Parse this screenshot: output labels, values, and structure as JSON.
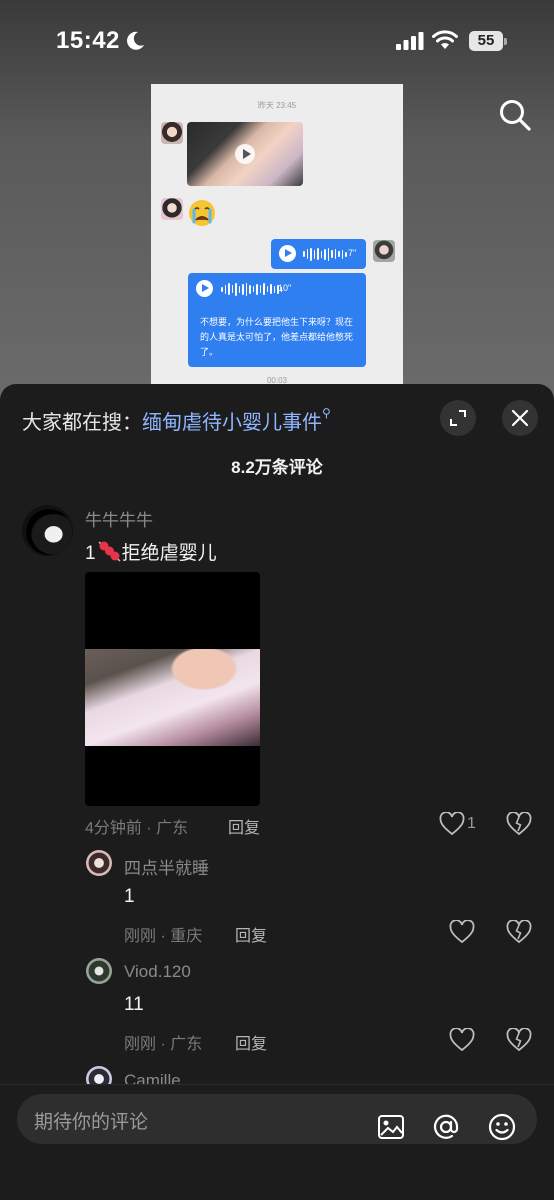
{
  "status_bar": {
    "time": "15:42",
    "battery": "55"
  },
  "chat_screenshot": {
    "timestamp": "昨天 23:45",
    "voice1_duration": "7\"",
    "voice2_duration": "10\"",
    "voice2_transcript": "不想要，为什么要把他生下来呀？现在的人真是太可怕了，他差点都给他憋死了。",
    "bottom_time": "00:03"
  },
  "panel": {
    "hot_search_prefix": "大家都在搜：",
    "hot_search_keyword": "缅甸虐待小婴儿事件",
    "comment_count": "8.2万条评论"
  },
  "comments": [
    {
      "username": "牛牛牛牛",
      "text_prefix": "1",
      "text": "拒绝虐婴儿",
      "meta": "4分钟前 · 广东",
      "reply_label": "回复",
      "likes": "1"
    }
  ],
  "replies": [
    {
      "username": "四点半就睡",
      "text": "1",
      "meta": "刚刚 · 重庆",
      "reply_label": "回复"
    },
    {
      "username": "Viod.120",
      "text": "11",
      "meta": "刚刚 · 广东",
      "reply_label": "回复"
    },
    {
      "username": "Camille"
    }
  ],
  "input": {
    "placeholder": "期待你的评论"
  },
  "colors": {
    "accent_blue": "#2f7ff0",
    "keyword_blue": "#8fb6ff",
    "panel_bg": "#1c1c1c"
  },
  "icons": [
    "moon-icon",
    "signal-icon",
    "wifi-icon",
    "search-icon",
    "expand-icon",
    "close-icon",
    "heart-icon",
    "broken-heart-icon",
    "image-icon",
    "at-icon",
    "emoji-icon"
  ]
}
